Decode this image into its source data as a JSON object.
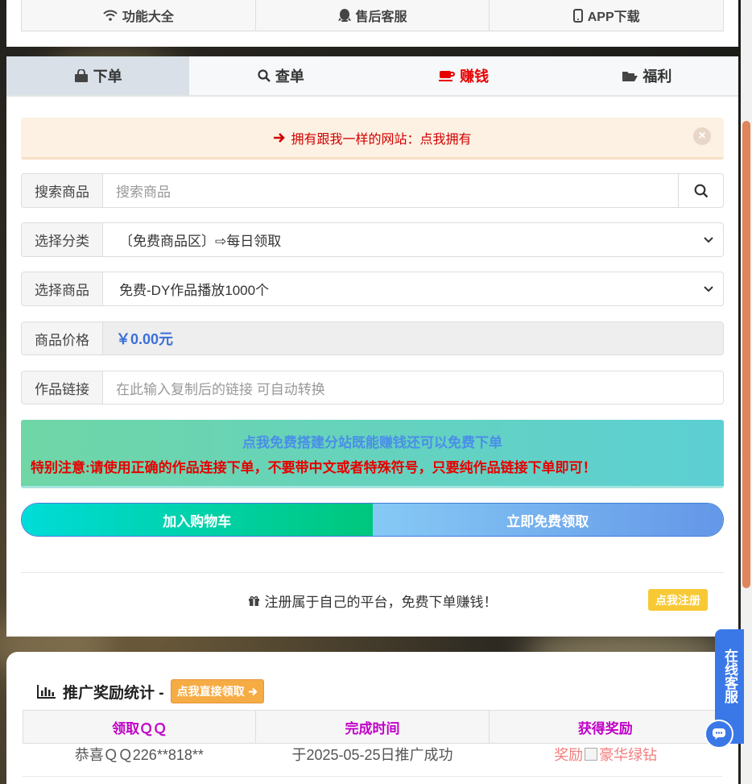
{
  "top_nav": [
    {
      "label": "功能大全",
      "icon": "wifi-icon"
    },
    {
      "label": "售后客服",
      "icon": "qq-icon"
    },
    {
      "label": "APP下载",
      "icon": "mobile-icon"
    }
  ],
  "tabs": [
    {
      "label": "下单",
      "icon": "shopping-bag-icon",
      "active": true
    },
    {
      "label": "查单",
      "icon": "search-icon"
    },
    {
      "label": "赚钱",
      "icon": "coffee-icon",
      "color": "#e60000"
    },
    {
      "label": "福利",
      "icon": "folder-open-icon"
    }
  ],
  "alert": {
    "text": "拥有跟我一样的网站：点我拥有",
    "icon": "arrow-right-icon"
  },
  "form": {
    "search": {
      "label": "搜索商品",
      "placeholder": "搜索商品"
    },
    "category": {
      "label": "选择分类",
      "value": "〔免费商品区〕⇨每日领取"
    },
    "product": {
      "label": "选择商品",
      "value": "免费-DY作品播放1000个"
    },
    "price": {
      "label": "商品价格",
      "value": "￥0.00元"
    },
    "link": {
      "label": "作品链接",
      "placeholder": "在此输入复制后的链接 可自动转换"
    }
  },
  "notice": {
    "line1": "点我免费搭建分站既能赚钱还可以免费下单",
    "line2": "特别注意:请使用正确的作品连接下单，不要带中文或者特殊符号，只要纯作品链接下单即可！"
  },
  "buttons": {
    "cart": "加入购物车",
    "free": "立即免费领取"
  },
  "register": {
    "text": "注册属于自己的平台，免费下单赚钱！",
    "button": "点我注册"
  },
  "stats": {
    "title": "推广奖励统计 -",
    "button": "点我直接领取",
    "columns": [
      "领取ＱＱ",
      "完成时间",
      "获得奖励"
    ],
    "rows": [
      {
        "qq": "恭喜ＱＱ226**818**",
        "time": "于2025-05-25日推广成功",
        "reward": "奖励",
        "reward_img_alt": "豪华绿钻"
      }
    ]
  },
  "kefu": {
    "label": "在线客服"
  },
  "colors": {
    "accent_red": "#e60000",
    "price_blue": "#3a6fd8",
    "kefu_blue": "#3a78e8",
    "scroll_thumb": "#e0845a"
  }
}
